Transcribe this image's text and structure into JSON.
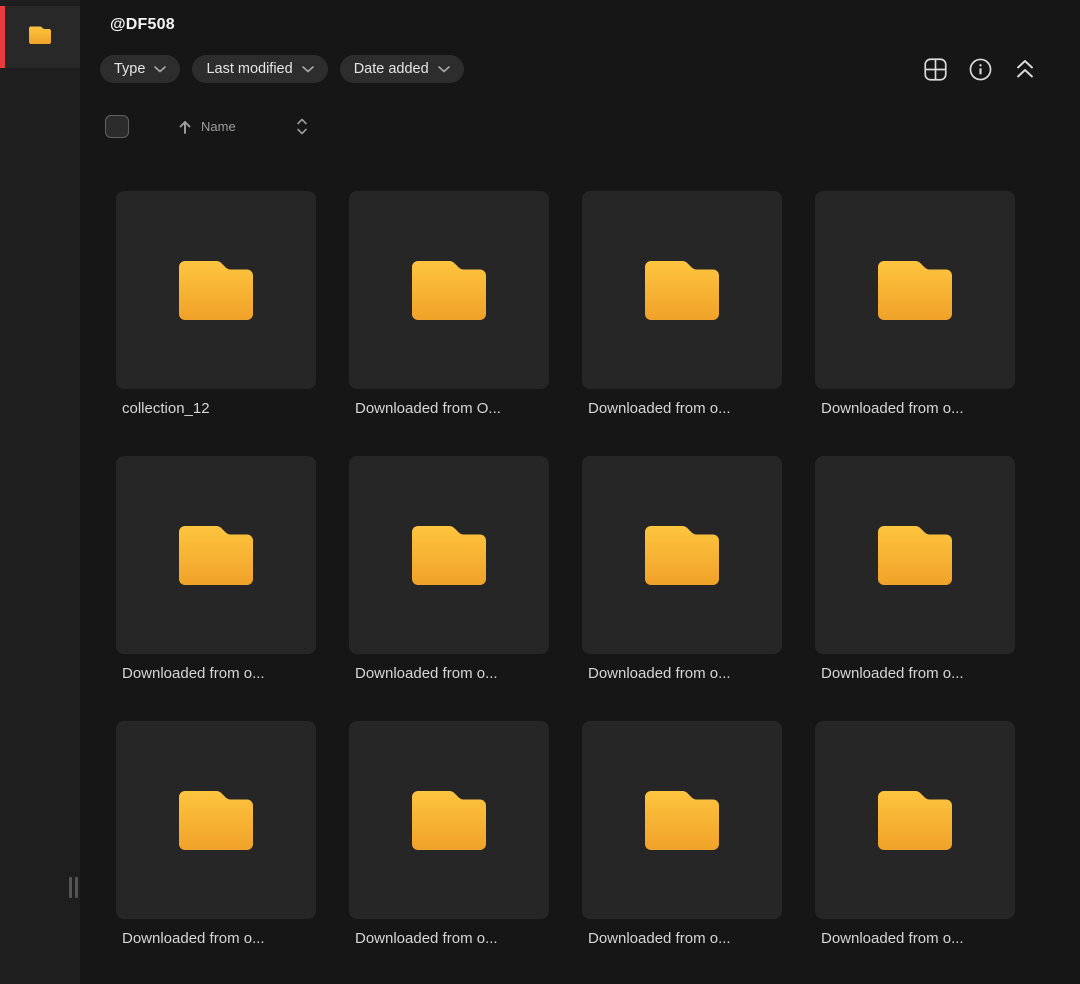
{
  "header": {
    "title": "@DF508"
  },
  "filters": {
    "type": "Type",
    "last_modified": "Last modified",
    "date_added": "Date added"
  },
  "toolbar": {
    "icons": [
      "grid-view-icon",
      "info-icon",
      "collapse-icon"
    ]
  },
  "sort_bar": {
    "select_all_checked": false,
    "field_label": "Name",
    "direction": "ascending"
  },
  "sidebar": {
    "selected_item_icon": "folder-icon"
  },
  "folders": [
    "collection_12",
    "Downloaded from O...",
    "Downloaded from o...",
    "Downloaded from o...",
    "Downloaded from o...",
    "Downloaded from o...",
    "Downloaded from o...",
    "Downloaded from o...",
    "Downloaded from o...",
    "Downloaded from o...",
    "Downloaded from o...",
    "Downloaded from o..."
  ],
  "colors": {
    "accent_red": "#e83c3c",
    "folder_top": "#fec53f",
    "folder_bottom": "#f0a229",
    "card_bg": "#262626",
    "page_bg": "#161616",
    "sidebar_bg": "#1e1e1e"
  }
}
